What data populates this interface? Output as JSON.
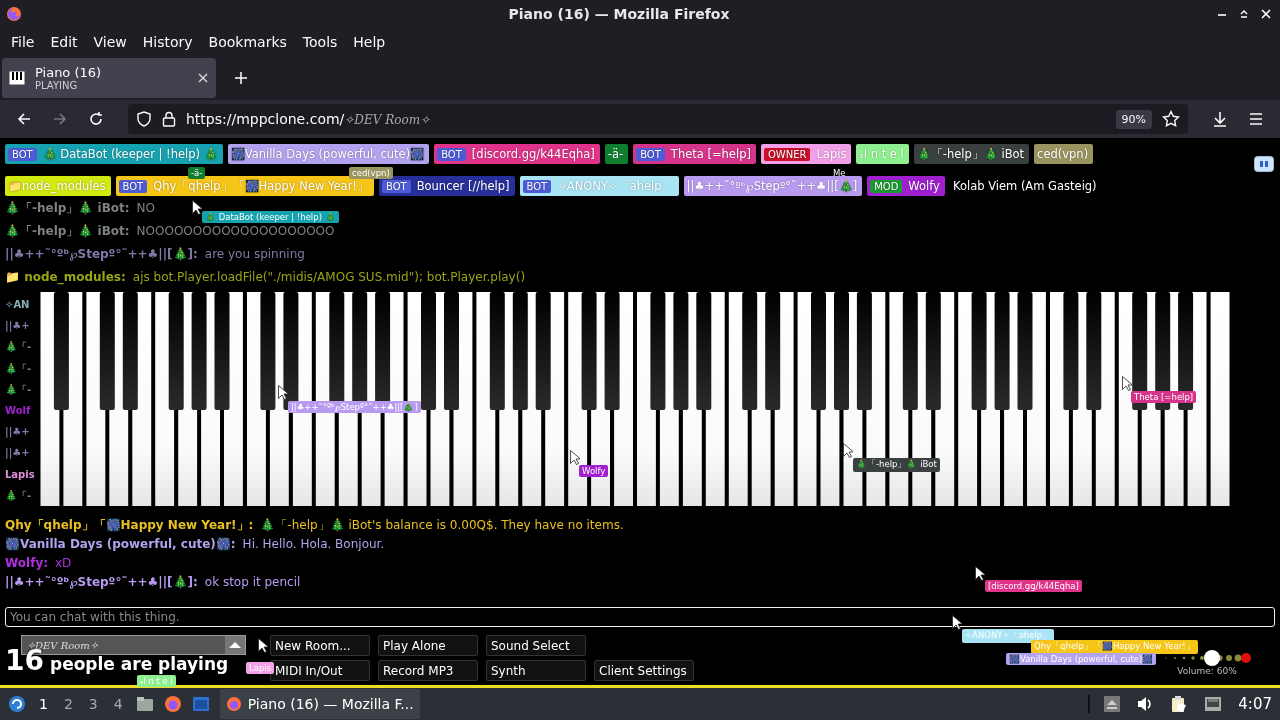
{
  "window": {
    "title": "Piano (16) — Mozilla Firefox"
  },
  "menu_bar": [
    "File",
    "Edit",
    "View",
    "History",
    "Bookmarks",
    "Tools",
    "Help"
  ],
  "tabs": [
    {
      "title": "Piano (16)",
      "subtitle": "PLAYING",
      "selected": true
    }
  ],
  "address_bar": {
    "url": "https://mppclone.com/",
    "url_path": "✧DEV Room✧",
    "zoom": "90%"
  },
  "user_list": [
    {
      "tag": "BOT",
      "name": "🎄 DataBot (keeper | !help) 🎄",
      "color": "#17a2b0"
    },
    {
      "name": "🎆Vanilla Days (powerful, cute)🎆",
      "color": "#b3a2ee"
    },
    {
      "tag": "BOT",
      "name": "[discord.gg/k44Eqha]",
      "color": "#e0338a"
    },
    {
      "name": "-ä-",
      "color": "#0f7f2f"
    },
    {
      "tag": "BOT",
      "name": "Theta [=help]",
      "color": "#d6348a"
    },
    {
      "tag": "OWNER",
      "name": "Lapis",
      "color": "#f2a0e8"
    },
    {
      "name": "ₛI n t e l",
      "color": "#8ef08e"
    },
    {
      "name": "🎄「-help」🎄 iBot",
      "color": "#3a3f3f"
    },
    {
      "name": "ced(vpn)",
      "color": "#9a9560"
    },
    {
      "name": "📁node_modules",
      "color": "#d2ea10"
    },
    {
      "tag": "BOT",
      "name": "Qhy「qhelp」「🎆Happy New Year!」",
      "color": "#f5c518"
    },
    {
      "tag": "BOT",
      "name": "Bouncer [//help]",
      "color": "#27309a"
    },
    {
      "tag": "BOT",
      "name": "✧ANONY✧「ahelp」",
      "color": "#a8e4f4"
    },
    {
      "name": "||♣++˜°ºᵇ℘Stepº°˜++♣||[🎄]",
      "color": "#b89af0"
    },
    {
      "tag": "MOD",
      "name": "Wolfy",
      "color": "#a020d0"
    },
    {
      "name": "Kolab Viem (Am Gasteig)"
    }
  ],
  "chat_top": [
    {
      "name": "🎄「-help」🎄 iBot:",
      "text": "NO",
      "color": "#7d8282"
    },
    {
      "name": "🎄「-help」🎄 iBot:",
      "text": "NOOOOOOOOOOOOOOOOOOOO",
      "color": "#7d8282"
    },
    {
      "name": "||♣++˜°ºᵇ℘Stepº°˜++♣||[🎄]:",
      "text": "are you spinning",
      "color": "#8578a8"
    },
    {
      "name": "📁 node_modules:",
      "text": "ajs bot.Player.loadFile(\"./midis/AMOG SUS.mid\"); bot.Player.play()",
      "color": "#9aa414"
    }
  ],
  "chat_behind_piano": [
    {
      "text": "✧AN",
      "color": "#8aaebc"
    },
    {
      "text": "||♣+",
      "color": "#8578a8"
    },
    {
      "text": "🎄「-"
    },
    {
      "text": "🎄「-"
    },
    {
      "text": "🎄「-"
    },
    {
      "text": "Wolf",
      "color": "#a020d0"
    },
    {
      "text": "||♣+",
      "color": "#8578a8"
    },
    {
      "text": "||♣+",
      "color": "#8578a8"
    },
    {
      "text": "Lapis",
      "color": "#e090d8"
    },
    {
      "text": "🎄「-"
    }
  ],
  "chat_bottom": [
    {
      "name": "Qhy「qhelp」「🎆Happy New Year!」:",
      "text": "🎄「-help」🎄 iBot's balance is 0.00Q$. They have no items.",
      "color": "#e8c020"
    },
    {
      "name": "🎆Vanilla Days (powerful, cute)🎆:",
      "text": "Hi. Hello. Hola. Bonjour.",
      "color": "#b3a2ee"
    },
    {
      "name": "Wolfy:",
      "text": "xD",
      "color": "#b030e0"
    },
    {
      "name": "||♣++˜°ºᵇ℘Stepº°˜++♣||[🎄]:",
      "text": "ok stop it pencil",
      "color": "#b89af0"
    }
  ],
  "cursor_labels": [
    {
      "name": "-ä-",
      "color": "#0f7f2f"
    },
    {
      "name": "ced(vpn)",
      "color": "#9a9560"
    },
    {
      "name": "Me"
    },
    {
      "name": "🎄 DataBot (keeper | !help) 🎄",
      "color": "#17a2b0"
    },
    {
      "name": "Theta [=help]",
      "color": "#d6348a"
    },
    {
      "name": "||♣++˜°ºᵇ℘Stepº°˜++♣||[🎄]",
      "color": "#b89af0"
    },
    {
      "name": "🎄「-help」🎄 iBot",
      "color": "#3a3f3f"
    },
    {
      "name": "Wolfy",
      "color": "#a020d0"
    },
    {
      "name": "[discord.gg/k44Eqha]",
      "color": "#e0338a"
    },
    {
      "name": "✧ANONY✧「ahelp」",
      "color": "#a8e4f4"
    },
    {
      "name": "Qhy「qhelp」「🎆Happy New Year!」",
      "color": "#f5c518"
    },
    {
      "name": "Lapis",
      "color": "#f2a0e8"
    },
    {
      "name": "🎆Vanilla Days (powerful, cute)🎆",
      "color": "#b3a2ee"
    },
    {
      "name": "ₛI n t e l",
      "color": "#8ef08e"
    }
  ],
  "chat_input": {
    "placeholder": "You can chat with this thing."
  },
  "room_select": {
    "value": "✧DEV Room✧"
  },
  "player_count": {
    "count": "16",
    "label": "people are playing"
  },
  "buttons": [
    "New Room...",
    "Play Alone",
    "Sound Select",
    "MIDI In/Out",
    "Record MP3",
    "Synth",
    "Client Settings"
  ],
  "volume": {
    "level": 0.6,
    "reading": "Volume: 60%"
  },
  "taskbar": {
    "workspaces": [
      {
        "label": "1",
        "selected": true
      },
      {
        "label": "2",
        "selected": false
      },
      {
        "label": "3",
        "selected": false
      },
      {
        "label": "4",
        "selected": false
      }
    ],
    "task": "Piano (16) — Mozilla F...",
    "clock": "4:07"
  }
}
